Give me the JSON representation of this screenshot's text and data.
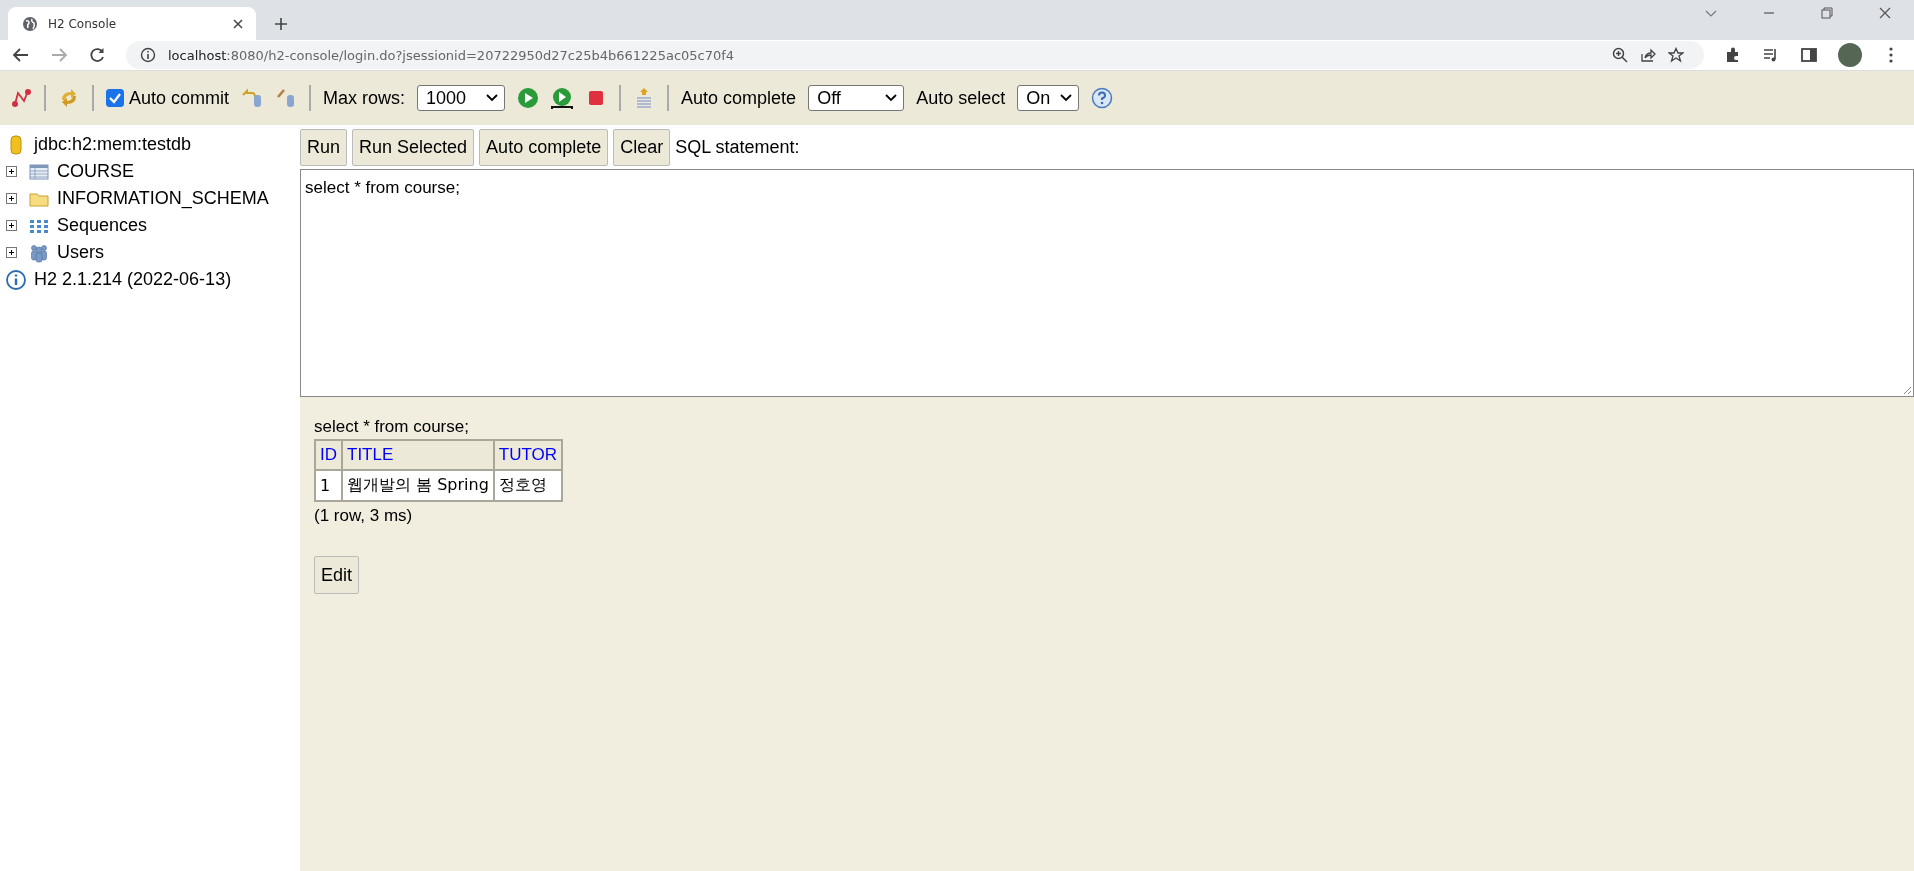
{
  "browser": {
    "tab_title": "H2 Console",
    "url_host": "localhost",
    "url_rest": ":8080/h2-console/login.do?jsessionid=20722950d27c25b4b661225ac05c70f4"
  },
  "toolbar": {
    "auto_commit": {
      "label": "Auto commit",
      "checked": true
    },
    "max_rows": {
      "label": "Max rows:",
      "value": "1000"
    },
    "auto_complete": {
      "label": "Auto complete",
      "value": "Off"
    },
    "auto_select": {
      "label": "Auto select",
      "value": "On"
    }
  },
  "tree": {
    "connection": "jdbc:h2:mem:testdb",
    "items": [
      {
        "label": "COURSE",
        "kind": "table",
        "expanded": false
      },
      {
        "label": "INFORMATION_SCHEMA",
        "kind": "folder",
        "expanded": false
      },
      {
        "label": "Sequences",
        "kind": "sequences",
        "expanded": false
      },
      {
        "label": "Users",
        "kind": "users",
        "expanded": false
      }
    ],
    "version": "H2 2.1.214 (2022-06-13)"
  },
  "sql_buttons": [
    "Run",
    "Run Selected",
    "Auto complete",
    "Clear"
  ],
  "sql_label": "SQL statement:",
  "sql_text": "select * from course;",
  "result": {
    "statement": "select * from course;",
    "columns": [
      "ID",
      "TITLE",
      "TUTOR"
    ],
    "rows": [
      [
        "1",
        "웹개발의 봄 Spring",
        "정호영"
      ]
    ],
    "summary": "(1 row, 3 ms)",
    "edit_button": "Edit"
  }
}
